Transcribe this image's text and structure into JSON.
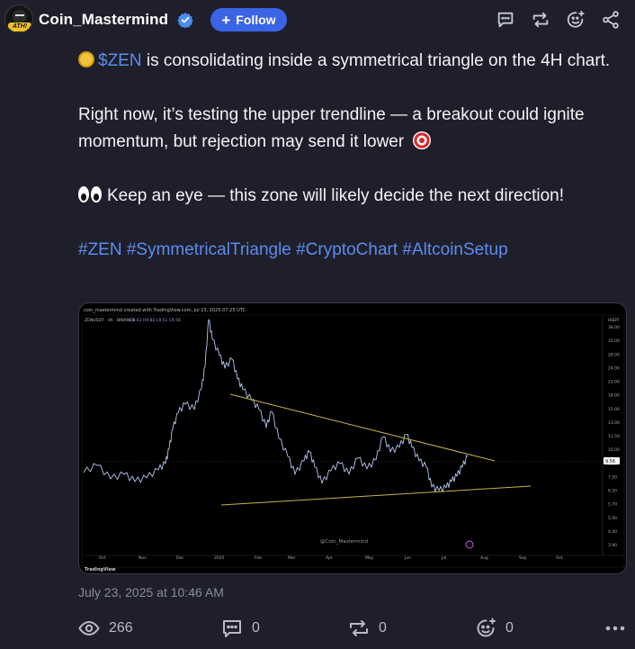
{
  "author": {
    "name": "Coin_Mastermind",
    "avatar_badge": "ATH!",
    "verified": true,
    "follow_label": "Follow"
  },
  "post": {
    "cashtag": "$ZEN",
    "line1_rest": " is consolidating inside a symmetrical triangle on the 4H chart.",
    "line2": "Right now, it’s testing the upper trendline — a breakout could ignite momentum, but rejection may send it lower",
    "line3": "Keep an eye — this zone will likely decide the next direction!",
    "hashtags": "#ZEN #SymmetricalTriangle #CryptoChart #AltcoinSetup"
  },
  "chart_image": {
    "header_text": "coin_mastermind created with TradingView.com, Jul 23, 2025 07:25 UTC",
    "symbol_line": "ZENUSDT · 4h · BINANCE",
    "ohlc_line": "O9.63 H9.82 L9.51 C9.56",
    "price_axis_unit": "USDT",
    "price_labels": [
      "38.00",
      "32.00",
      "28.00",
      "24.00",
      "21.00",
      "18.00",
      "15.00",
      "13.00",
      "11.50",
      "10.00",
      "9.56",
      "8.50",
      "7.50",
      "6.50",
      "5.70",
      "5.00",
      "4.40",
      "3.90"
    ],
    "time_labels": [
      "Oct",
      "Nov",
      "Dec",
      "2025",
      "Feb",
      "Mar",
      "Apr",
      "May",
      "Jun",
      "Jul",
      "Aug",
      "Sep",
      "Oct"
    ],
    "watermark": "@Coin_Mastermind",
    "brand": "TradingView",
    "current_price": "9.56",
    "colors": {
      "candles": "#b7c6ef",
      "trendline": "#c9b44a",
      "price_marker": "#ffffff"
    }
  },
  "timestamp": "July 23, 2025 at 10:46 AM",
  "stats": {
    "views": "266",
    "comments": "0",
    "reposts": "0",
    "likes": "0"
  },
  "icons": [
    "verified-icon",
    "plus-icon",
    "comment-icon",
    "repost-icon",
    "like-icon",
    "share-icon",
    "eye-icon",
    "more-icon"
  ]
}
